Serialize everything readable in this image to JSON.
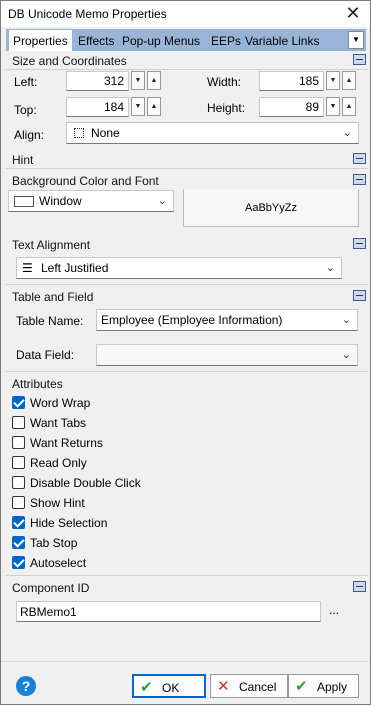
{
  "window": {
    "title": "DB Unicode Memo Properties"
  },
  "tabs": [
    "Properties",
    "Effects",
    "Pop-up Menus",
    "EEPs",
    "Variable Links"
  ],
  "active_tab": "Properties",
  "size_coords": {
    "header": "Size and Coordinates",
    "left_label": "Left:",
    "left_value": "312",
    "top_label": "Top:",
    "top_value": "184",
    "width_label": "Width:",
    "width_value": "185",
    "height_label": "Height:",
    "height_value": "89",
    "align_label": "Align:",
    "align_value": "None"
  },
  "hint": {
    "header": "Hint"
  },
  "bg_font": {
    "header": "Background Color and Font",
    "color_value": "Window",
    "color_swatch": "#ffffff",
    "font_sample": "AaBbYyZz"
  },
  "text_alignment": {
    "header": "Text Alignment",
    "value": "Left Justified"
  },
  "table_field": {
    "header": "Table and Field",
    "table_label": "Table Name:",
    "table_value": "Employee  (Employee Information)",
    "field_label": "Data Field:",
    "field_value": ""
  },
  "attributes": {
    "header": "Attributes",
    "items": [
      {
        "label": "Word Wrap",
        "checked": true
      },
      {
        "label": "Want Tabs",
        "checked": false
      },
      {
        "label": "Want Returns",
        "checked": false
      },
      {
        "label": "Read Only",
        "checked": false
      },
      {
        "label": "Disable Double Click",
        "checked": false
      },
      {
        "label": "Show Hint",
        "checked": false
      },
      {
        "label": "Hide Selection",
        "checked": true
      },
      {
        "label": "Tab Stop",
        "checked": true
      },
      {
        "label": "Autoselect",
        "checked": true
      }
    ]
  },
  "component_id": {
    "header": "Component ID",
    "value": "RBMemo1",
    "browse_label": "..."
  },
  "buttons": {
    "ok": "OK",
    "cancel": "Cancel",
    "apply": "Apply",
    "help": "?"
  },
  "colors": {
    "tabstrip": "#9ab4d8",
    "accent": "#0067c0",
    "ok_check": "#2e9e3a",
    "cancel_x": "#d32f2f"
  }
}
